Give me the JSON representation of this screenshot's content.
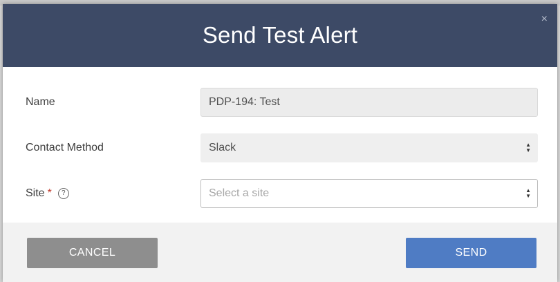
{
  "modal": {
    "title": "Send Test Alert",
    "close_glyph": "×"
  },
  "form": {
    "name": {
      "label": "Name",
      "value": "PDP-194: Test"
    },
    "contact_method": {
      "label": "Contact Method",
      "value": "Slack"
    },
    "site": {
      "label": "Site",
      "required_mark": "*",
      "help_glyph": "?",
      "placeholder": "Select a site"
    }
  },
  "footer": {
    "cancel_label": "CANCEL",
    "send_label": "SEND"
  },
  "colors": {
    "header_bg": "#3d4a66",
    "send_button": "#4f7cc4",
    "cancel_button": "#8e8e8e",
    "required": "#c0392b"
  },
  "icons": {
    "close": "close-icon",
    "help": "help-circle-icon",
    "select_arrows": "sort-arrows-icon"
  }
}
